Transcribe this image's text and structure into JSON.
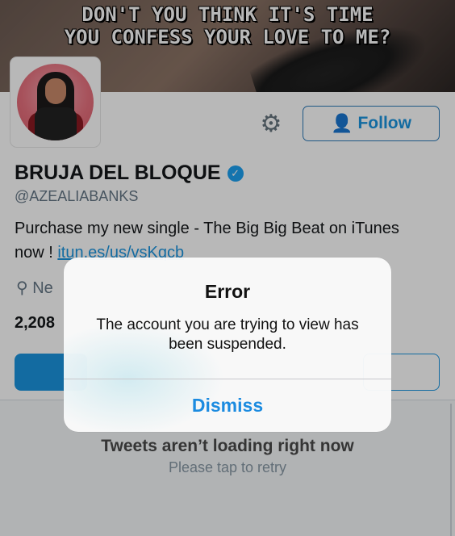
{
  "banner": {
    "text": "DON'T YOU THINK IT'S TIME\nYOU CONFESS YOUR LOVE TO ME?"
  },
  "profile": {
    "name": "BRUJA DEL BLOQUE",
    "handle": "@AZEALIABANKS",
    "bio_text": "Purchase my new single - The Big Big Beat on iTunes now ! ",
    "bio_link": "itun.es/us/vsKqcb",
    "location": "Ne",
    "count": "2,208",
    "follow_label": "Follow",
    "verified_icon": "verified-badge-icon",
    "settings_icon": "gear-icon"
  },
  "timeline": {
    "title": "Tweets aren’t loading right now",
    "subtitle": "Please tap to retry"
  },
  "alert": {
    "title": "Error",
    "message": "The account you are trying to view has been suspended.",
    "dismiss_label": "Dismiss"
  },
  "colors": {
    "accent": "#1b95e0",
    "alert_button": "#1b8be0"
  }
}
